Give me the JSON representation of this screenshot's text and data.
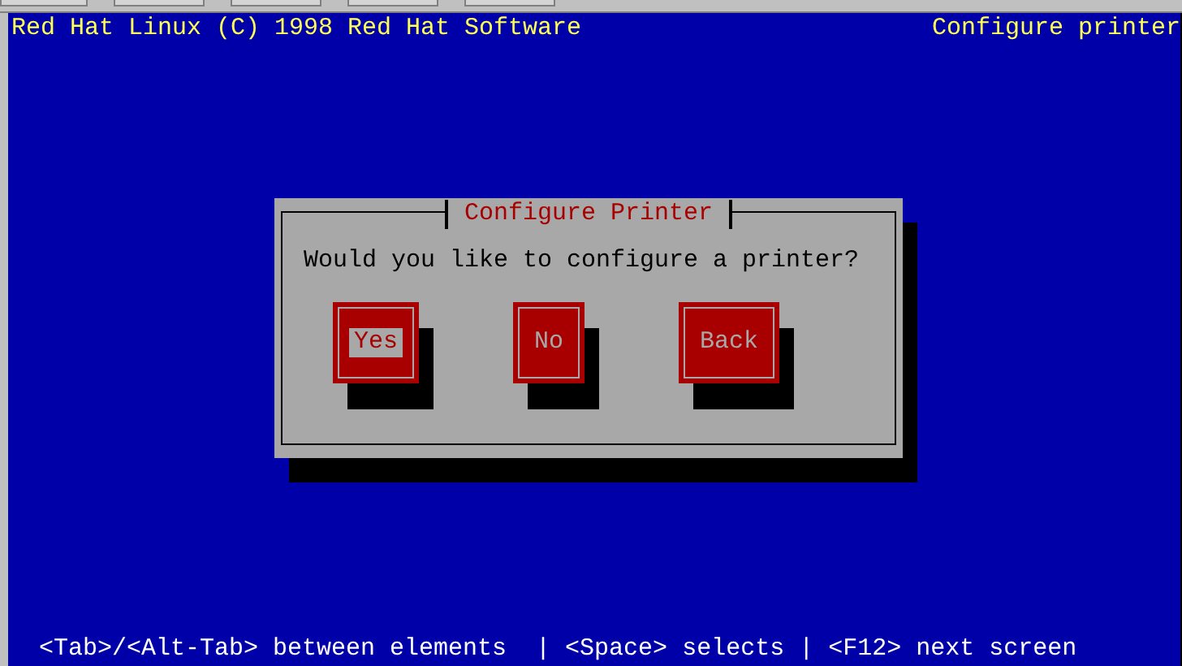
{
  "header": {
    "left": "Red Hat Linux (C) 1998 Red Hat Software",
    "right": "Configure printer"
  },
  "dialog": {
    "title": "Configure Printer",
    "message": "Would you like to configure a printer?",
    "buttons": [
      {
        "label": "Yes",
        "selected": true
      },
      {
        "label": "No",
        "selected": false
      },
      {
        "label": "Back",
        "selected": false
      }
    ]
  },
  "help_line": "<Tab>/<Alt-Tab> between elements  | <Space> selects | <F12> next screen"
}
